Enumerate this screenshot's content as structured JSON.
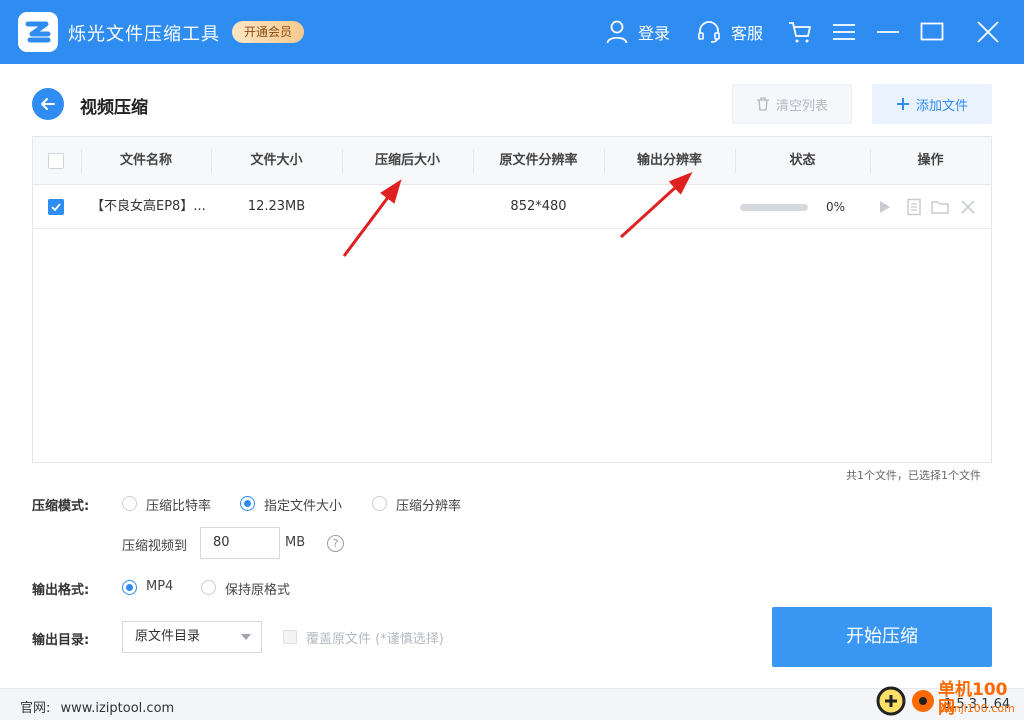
{
  "app": {
    "title": "烁光文件压缩工具",
    "vip_label": "开通会员",
    "login_label": "登录",
    "service_label": "客服"
  },
  "page": {
    "title": "视频压缩",
    "clear_list_label": "清空列表",
    "add_file_label": "添加文件"
  },
  "table": {
    "headers": [
      "文件名称",
      "文件大小",
      "压缩后大小",
      "原文件分辨率",
      "输出分辨率",
      "状态",
      "操作"
    ],
    "rows": [
      {
        "checked": true,
        "name": "【不良女高EP8】...",
        "size": "12.23MB",
        "compressed_size": "",
        "original_resolution": "852*480",
        "output_resolution": "",
        "progress": 0,
        "progress_text": "0%"
      }
    ],
    "summary": "共1个文件，已选择1个文件"
  },
  "options": {
    "mode_label": "压缩模式:",
    "modes": [
      "压缩比特率",
      "指定文件大小",
      "压缩分辨率"
    ],
    "selected_mode": "指定文件大小",
    "target_label": "压缩视频到",
    "target_value": "80",
    "target_unit": "MB",
    "help_mark": "?",
    "format_label": "输出格式:",
    "formats": [
      "MP4",
      "保持原格式"
    ],
    "selected_format": "MP4",
    "output_dir_label": "输出目录:",
    "output_dir_value": "原文件目录",
    "overwrite_label": "覆盖原文件 (*谨慎选择)",
    "start_label": "开始压缩"
  },
  "footer": {
    "site_label": "官网:",
    "site_url": "www.iziptool.com",
    "version": "1.5.3.1.64"
  },
  "watermark": {
    "text": "单机100网",
    "sub": "danji100.com"
  },
  "colors": {
    "primary": "#2f8cf1",
    "annotation_arrow": "#e02020",
    "watermark": "#ff6a00"
  }
}
